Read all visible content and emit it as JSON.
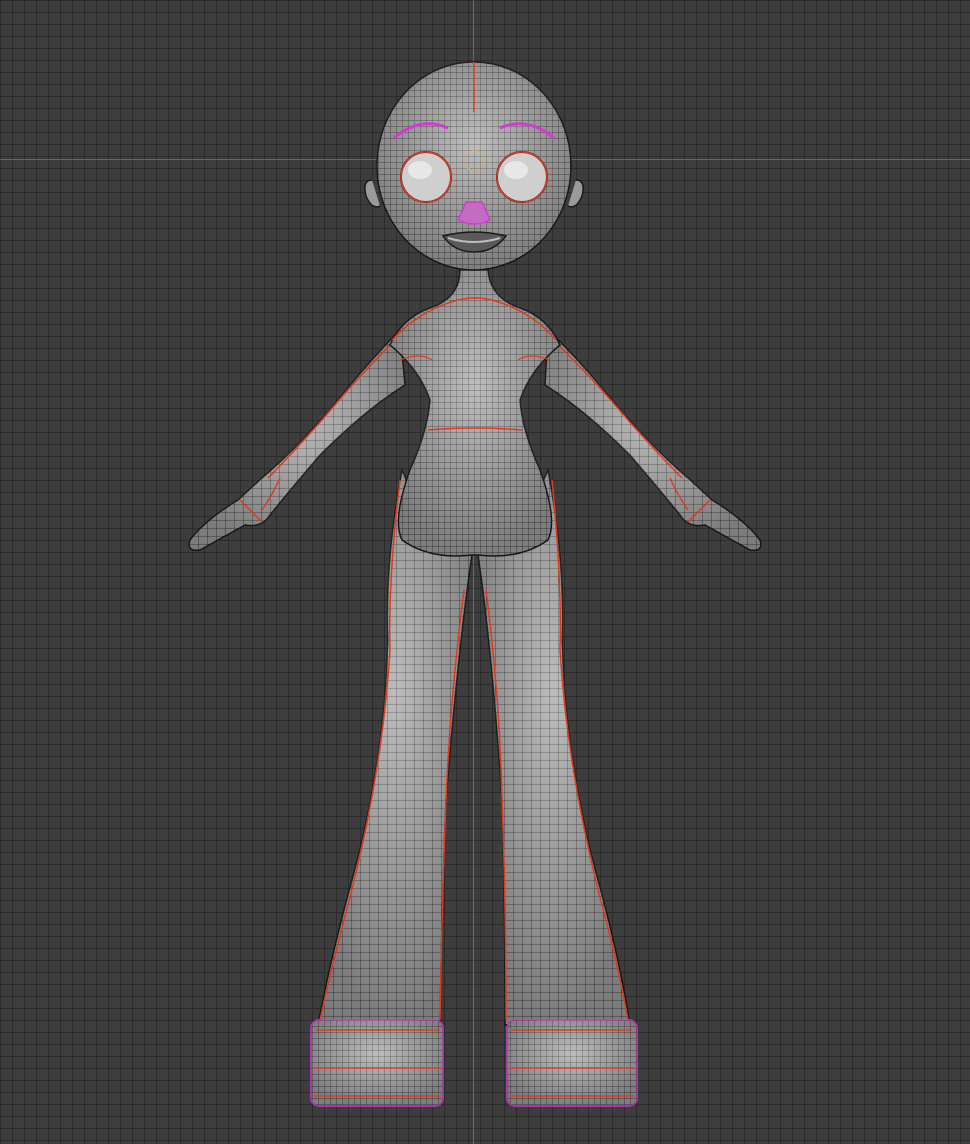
{
  "viewport": {
    "colors": {
      "background": "#3d3d3d",
      "grid": "#2f2f2f",
      "x_axis": "#b04646",
      "z_axis": "#3f6fa8",
      "mesh_fill": "#a9a9a9",
      "wire": "#1e1e1e",
      "seam": "#e03a1e",
      "selected_edges": "#d23ad2"
    },
    "object": {
      "icon": "mesh-character-icon"
    }
  }
}
